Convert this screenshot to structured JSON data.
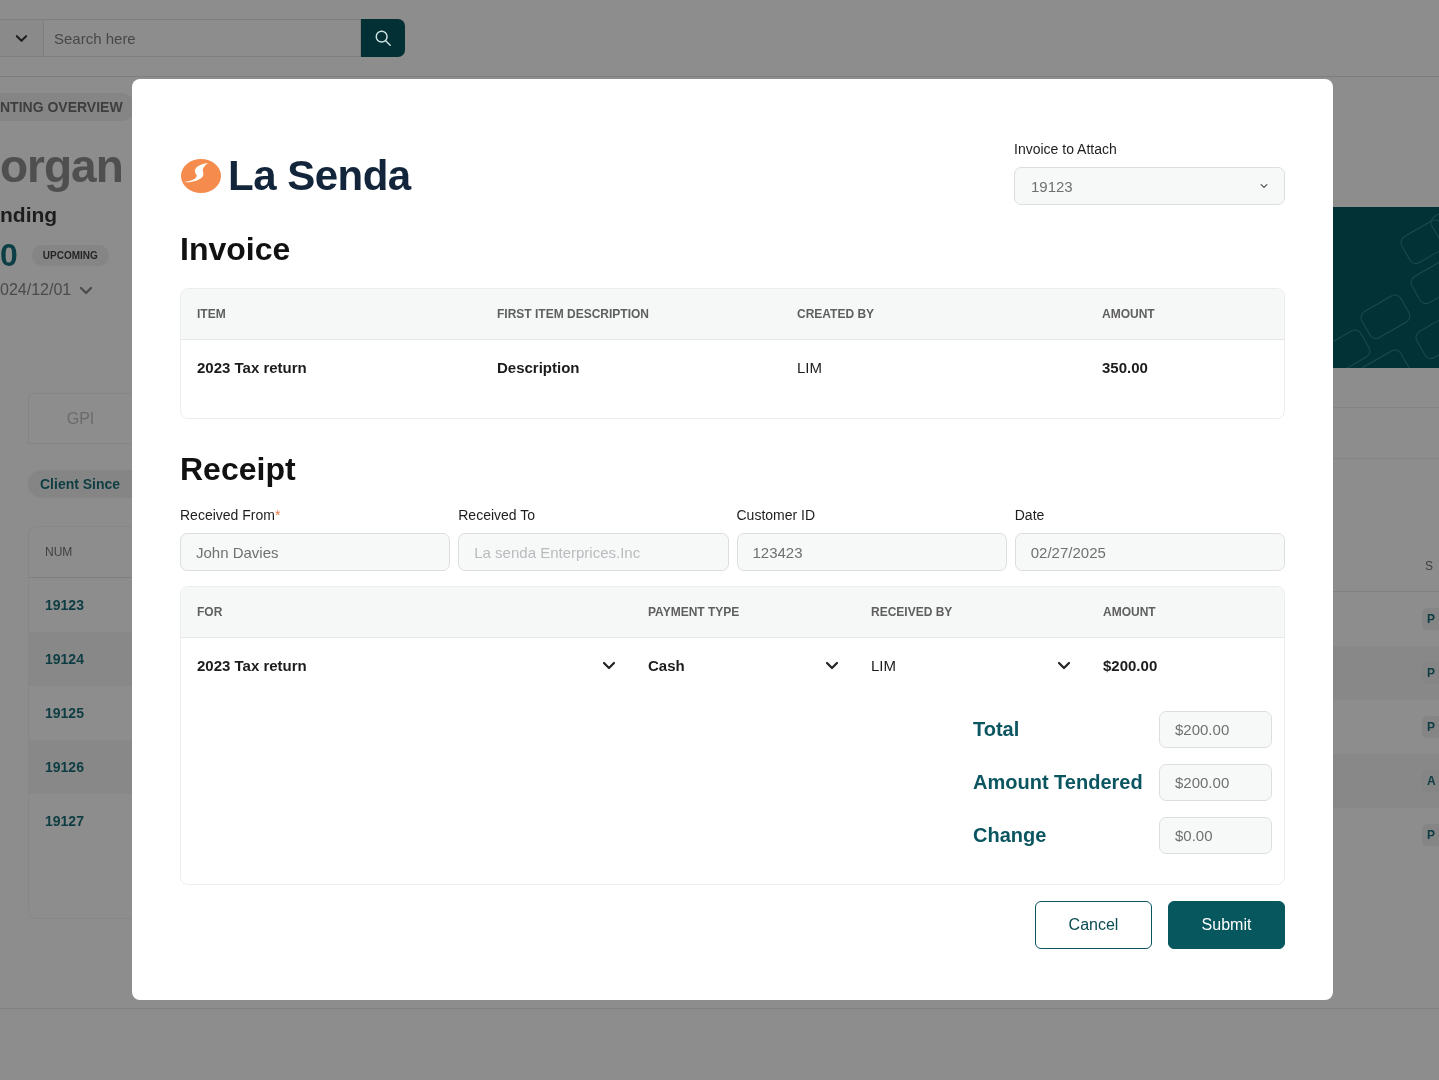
{
  "background": {
    "search": {
      "placeholder": "Search here"
    },
    "breadcrumb": "NTING OVERVIEW",
    "client_name": "organ",
    "subtitle": "nding",
    "count": "0",
    "count_badge": "UPCOMING",
    "date": "024/12/01",
    "tab": "GPI",
    "client_since": "Client Since",
    "table": {
      "columns": [
        "NUM",
        "S"
      ],
      "rows": [
        {
          "num": "19123",
          "status": "P"
        },
        {
          "num": "19124",
          "status": "P"
        },
        {
          "num": "19125",
          "status": "P"
        },
        {
          "num": "19126",
          "status": "A"
        },
        {
          "num": "19127",
          "status": "P"
        }
      ]
    }
  },
  "modal": {
    "logo": "La Senda",
    "attach": {
      "label": "Invoice to Attach",
      "value": "19123"
    },
    "invoice": {
      "title": "Invoice",
      "columns": [
        "ITEM",
        "FIRST ITEM DESCRIPTION",
        "CREATED BY",
        "AMOUNT"
      ],
      "rows": [
        [
          "2023 Tax return",
          "Description",
          "LIM",
          "350.00"
        ]
      ]
    },
    "receipt": {
      "title": "Receipt",
      "fields": [
        {
          "label": "Received From",
          "required_mark": "*",
          "value": "John Davies"
        },
        {
          "label": "Received To",
          "placeholder": "La senda Enterprices.Inc"
        },
        {
          "label": "Customer ID",
          "value": "123423"
        },
        {
          "label": "Date",
          "value": "02/27/2025"
        }
      ],
      "columns": [
        "FOR",
        "PAYMENT TYPE",
        "RECEIVED BY",
        "AMOUNT"
      ],
      "line": {
        "for": "2023 Tax return",
        "payment_type": "Cash",
        "received_by": "LIM",
        "amount": "$200.00"
      },
      "totals": [
        {
          "label": "Total",
          "value": "$200.00"
        },
        {
          "label": "Amount Tendered",
          "value": "$200.00"
        },
        {
          "label": "Change",
          "value": "$0.00"
        }
      ]
    },
    "buttons": [
      {
        "label": "Cancel",
        "kind": "secondary"
      },
      {
        "label": "Submit",
        "kind": "primary"
      }
    ]
  }
}
